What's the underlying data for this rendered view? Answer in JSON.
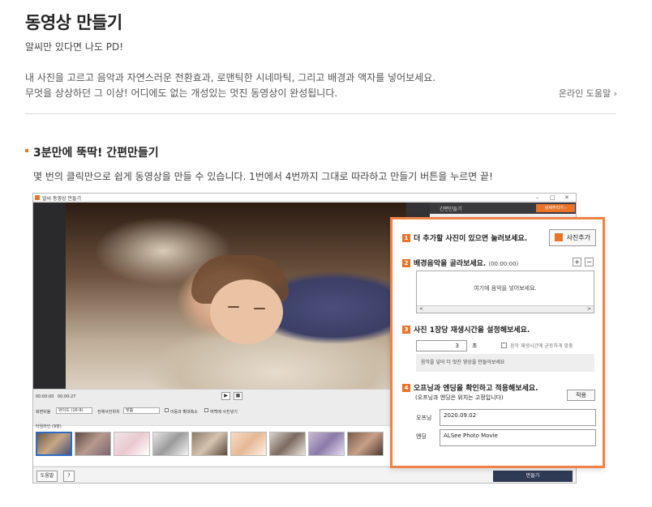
{
  "header": {
    "title": "동영상 만들기",
    "subtitle": "알씨만 있다면 나도 PD!",
    "desc_line1": "내 사진을 고르고 음악과 자연스러운 전환효과, 로맨틱한 시네마틱, 그리고 배경과 액자를 넣어보세요.",
    "desc_line2": "무엇을 상상하던 그 이상! 어디에도 없는 개성있는 멋진 동영상이 완성됩니다.",
    "help_link": "온라인 도움말 ›"
  },
  "section": {
    "title": "3분만에 뚝딱! 간편만들기",
    "desc": "몇 번의 클릭만으로 쉽게 동영상을 만들 수 있습니다. 1번에서 4번까지 그대로 따라하고 만들기 버튼을 누르면 끝!"
  },
  "app": {
    "window_title": "알씨 동영상 만들기",
    "window_controls": [
      "–",
      "□",
      "✕"
    ],
    "side_tab": "간편만들기",
    "detail_button": "상세주리기 ›",
    "time_current": "00:00:00",
    "time_total": "00:00:27",
    "play_glyph": "▶",
    "stop_glyph": "■",
    "ratio_label": "화면비율",
    "ratio_value": "와이드 (16:9)",
    "arrange_label": "전체사진위치",
    "arrange_value": "맞춤",
    "opt1": "이동과 확대축소",
    "opt2": "여백에 사진넣기",
    "timeline_label": "타임라인 (9장)",
    "help_button": "도움말",
    "question_button": "?",
    "make_button": "만들기"
  },
  "panel": {
    "step1": {
      "num": "1",
      "text": "더 추가할 사진이 있으면 눌러보세요."
    },
    "add_photo_button": "사진추가",
    "step2": {
      "num": "2",
      "text": "배경음악을 골라보세요.",
      "sub": "(00:00:00)"
    },
    "plus_button": "+",
    "minus_button": "−",
    "music_placeholder": "여기에 음악을 넣어보세요.",
    "scroll_left": "<",
    "scroll_right": ">",
    "step3": {
      "num": "3",
      "text": "사진 1장당 재생시간을 설정해보세요."
    },
    "duration_value": "3",
    "duration_unit": "초",
    "fit_music_label": "음악 재생시간에 균등하게 맞춤",
    "notice": "음악을 넣어 더 멋진 영상을 만들어보세요",
    "step4": {
      "num": "4",
      "text": "오프닝과 엔딩을 확인하고 적용해보세요.",
      "sub": "(오프닝과 엔딩은 위치는 고정입니다)"
    },
    "apply_button": "적용",
    "opening_label": "오프닝",
    "opening_value": "2020.09.02",
    "ending_label": "엔딩",
    "ending_value": "ALSee Photo Movie"
  }
}
